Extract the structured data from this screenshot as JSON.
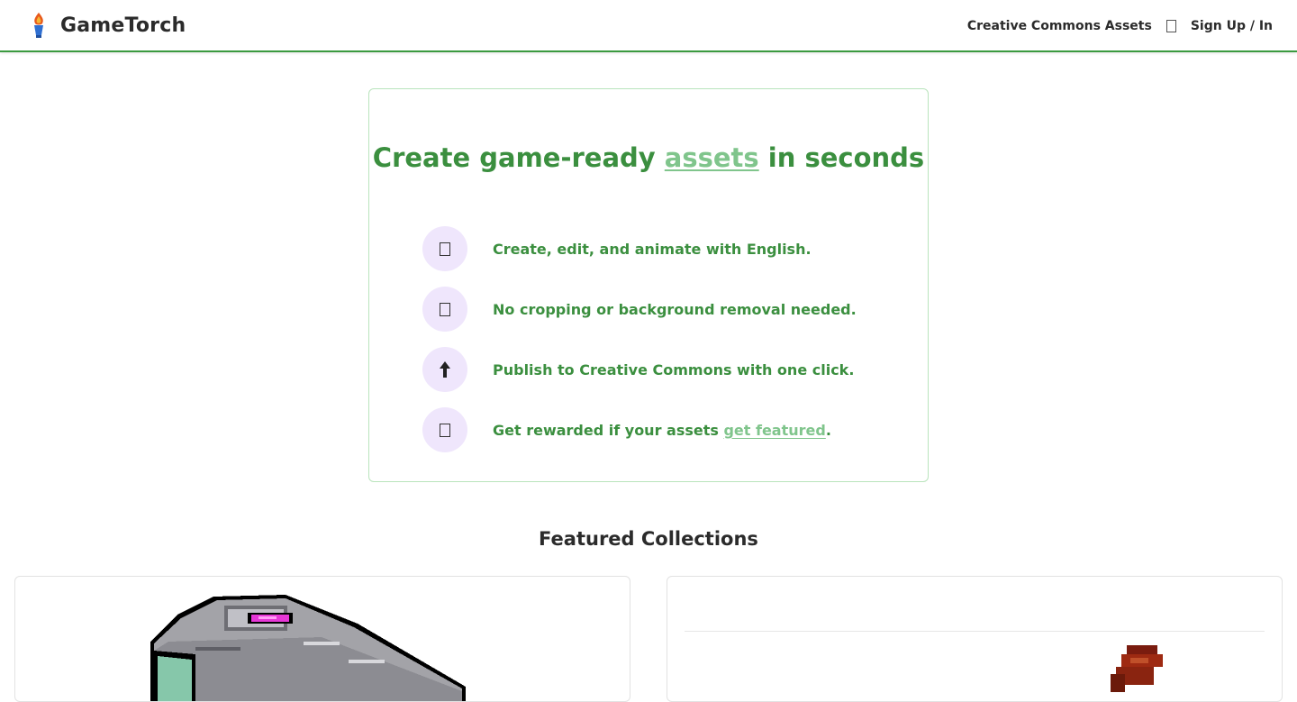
{
  "header": {
    "brand": "GameTorch",
    "nav": {
      "assets_link": "Creative Commons Assets",
      "auth_link": "Sign Up / In"
    }
  },
  "hero": {
    "title_before": "Create game-ready ",
    "title_highlight": "assets",
    "title_after": " in seconds",
    "features": [
      {
        "icon": "placeholder-glyph-icon",
        "text": "Create, edit, and animate with English."
      },
      {
        "icon": "placeholder-glyph-icon",
        "text": "No cropping or background removal needed."
      },
      {
        "icon": "up-arrow-icon",
        "text": "Publish to Creative Commons with one click."
      },
      {
        "icon": "placeholder-glyph-icon",
        "text_before": "Get rewarded if your assets ",
        "link": "get featured",
        "text_after": "."
      }
    ]
  },
  "featured": {
    "heading": "Featured Collections"
  },
  "colors": {
    "accent_green": "#3b8f3f",
    "light_green": "#80c58c",
    "icon_bg": "#efe6fc",
    "header_border": "#3b9a40"
  }
}
